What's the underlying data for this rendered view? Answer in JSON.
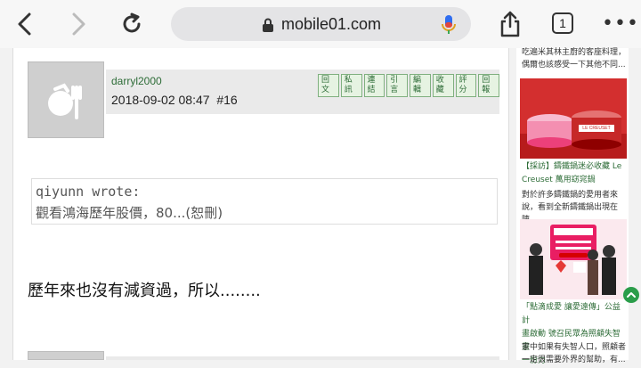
{
  "browser": {
    "url": "mobile01.com",
    "tab_count": "1"
  },
  "post": {
    "username": "darryl2000",
    "datetime": "2018-09-02 08:47",
    "floor": "#16",
    "actions": [
      "回文",
      "私訊",
      "連結",
      "引言",
      "編輯",
      "收藏",
      "評分",
      "回報"
    ],
    "quote_author": "qiyunn wrote:",
    "quote_text": "觀看鴻海歷年股價，80...(恕刪)",
    "body": "歷年來也沒有減資過，所以........"
  },
  "sidebar": {
    "top_snippet_1": "吃遍米其林主廚的客座料理，",
    "top_snippet_2": "偶爾也該感受一下其他不同...",
    "article1_title_1": "【採訪】鑄鐵鍋迷必收藏 Le",
    "article1_title_2": "Creuset 萬用窈窕鍋",
    "article1_desc_1": "對於許多鑄鐵鍋的愛用者來",
    "article1_desc_2": "說，看到全新鑄鐵鍋出現在陳...",
    "article1_image_brand": "LE CREUSET",
    "article2_title_1": "「點滴成愛 讓愛遠傳」公益計",
    "article2_title_2": "畫啟動 號召民眾為照顧失智畫",
    "article2_title_3": "一份力",
    "article2_desc_1": "家中如果有失智人口，照顧者",
    "article2_desc_2": "一定很需要外界的幫助，有..."
  },
  "colors": {
    "link_green": "#2d6c37",
    "fab_green": "#2a9d4a"
  }
}
